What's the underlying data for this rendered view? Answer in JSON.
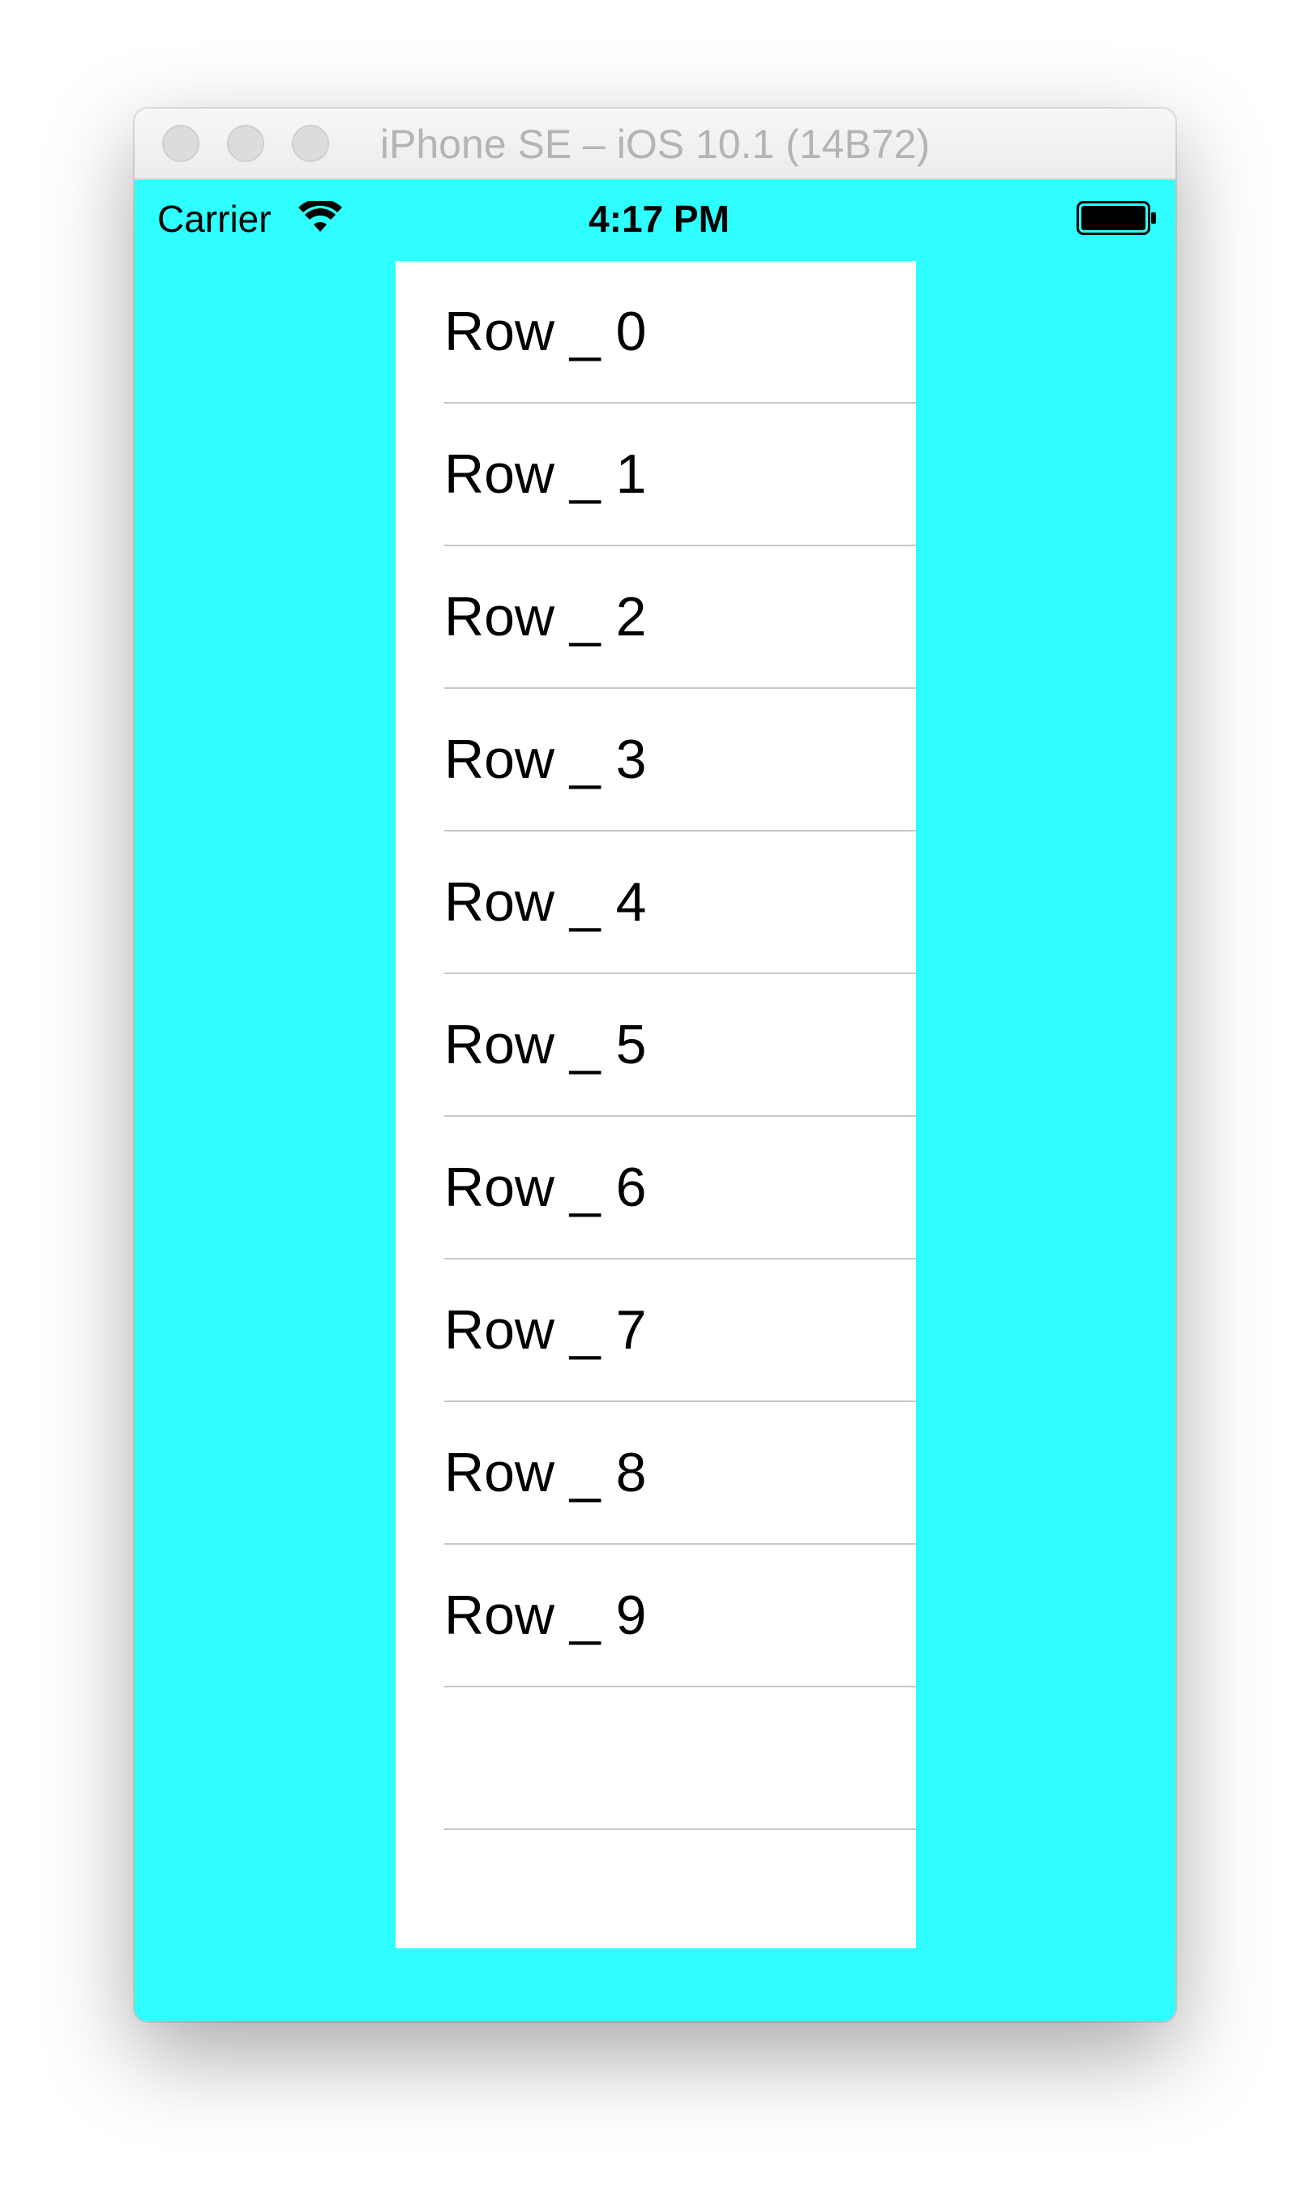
{
  "window": {
    "title": "iPhone SE – iOS 10.1 (14B72)"
  },
  "status_bar": {
    "carrier": "Carrier",
    "time": "4:17 PM",
    "wifi_icon": "wifi-icon",
    "battery_icon": "battery-full-icon"
  },
  "colors": {
    "screen_background": "#2EFEFF",
    "table_background": "#FFFFFF",
    "separator": "#C8C7CC"
  },
  "table": {
    "rows": [
      {
        "label": "Row _ 0"
      },
      {
        "label": "Row _ 1"
      },
      {
        "label": "Row _ 2"
      },
      {
        "label": "Row _ 3"
      },
      {
        "label": "Row _ 4"
      },
      {
        "label": "Row _ 5"
      },
      {
        "label": "Row _ 6"
      },
      {
        "label": "Row _ 7"
      },
      {
        "label": "Row _ 8"
      },
      {
        "label": "Row _ 9"
      },
      {
        "label": ""
      },
      {
        "label": ""
      }
    ]
  }
}
